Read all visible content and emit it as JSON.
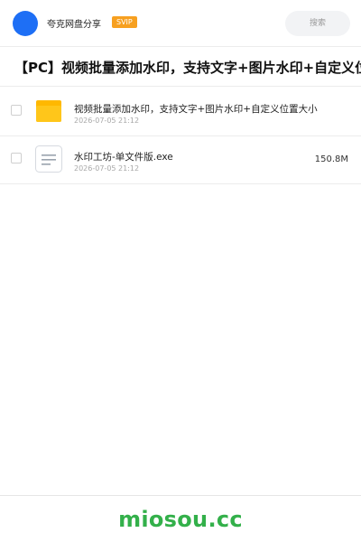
{
  "header": {
    "username": "夸克网盘分享",
    "badge": "SVIP",
    "search_label": "搜索"
  },
  "share": {
    "title": "【PC】视频批量添加水印，支持文字+图片水印+自定义位置大小"
  },
  "files": [
    {
      "name": "视频批量添加水印，支持文字+图片水印+自定义位置大小",
      "date": "2026-07-05 21:12",
      "size": "",
      "icon": "folder-icon"
    },
    {
      "name": "水印工坊-单文件版.exe",
      "date": "2026-07-05 21:12",
      "size": "150.8M",
      "icon": "document-icon"
    }
  ],
  "footer": {
    "brand": "miosou.cc"
  },
  "colors": {
    "accent": "#1e6ff5",
    "badge": "#f7a020",
    "folder": "#ffc61a",
    "brand": "#33b04a"
  }
}
